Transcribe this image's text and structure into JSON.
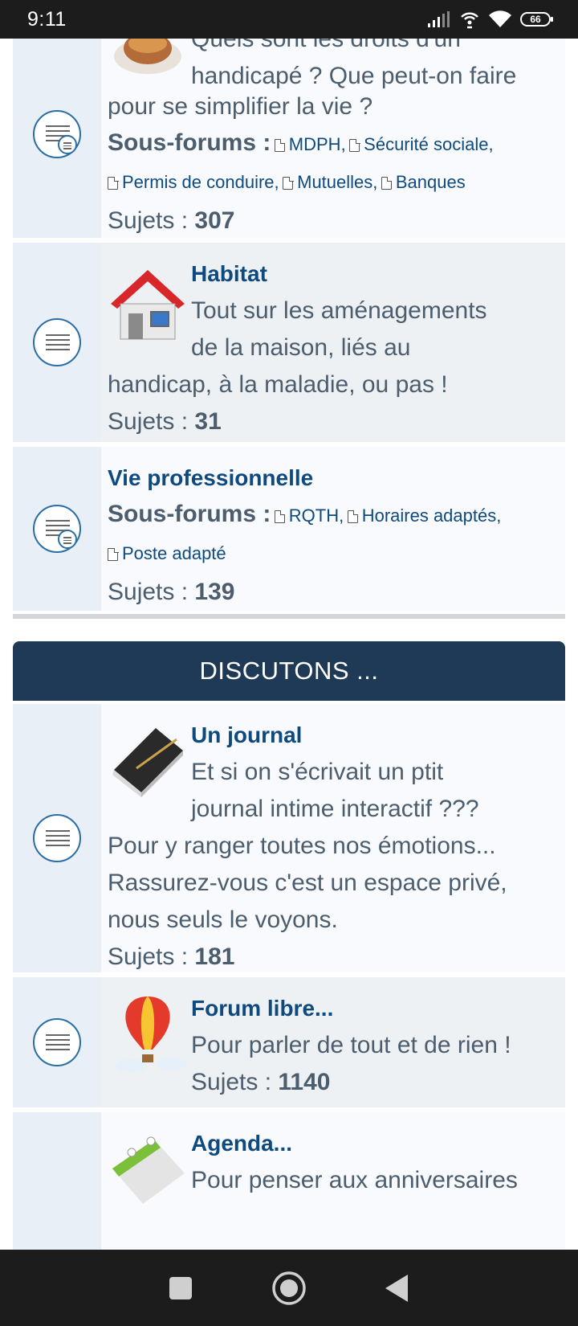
{
  "status_bar": {
    "time": "9:11",
    "battery": "66"
  },
  "forums_top": [
    {
      "desc_lines": [
        "Quels sont les droits d'un",
        "handicapé ? Que peut-on faire",
        "pour se simplifier la vie ?"
      ],
      "sub_label": "Sous-forums :",
      "subforums": [
        "MDPH",
        "Sécurité sociale",
        "Permis de conduire",
        "Mutuelles",
        "Banques"
      ],
      "topics_label": "Sujets :",
      "topics": "307"
    },
    {
      "title": "Habitat",
      "desc_lines": [
        "Tout sur les aménagements",
        "de la maison, liés au",
        "handicap, à la maladie, ou pas !"
      ],
      "topics_label": "Sujets :",
      "topics": "31"
    },
    {
      "title": "Vie professionnelle",
      "sub_label": "Sous-forums :",
      "subforums": [
        "RQTH",
        "Horaires adaptés",
        "Poste adapté"
      ],
      "topics_label": "Sujets :",
      "topics": "139"
    }
  ],
  "category": {
    "title": "DISCUTONS ..."
  },
  "forums_bottom": [
    {
      "title": "Un journal",
      "desc_lines": [
        "Et si on s'écrivait un ptit",
        "journal intime interactif ???",
        "Pour y ranger toutes nos émotions...",
        "Rassurez-vous c'est un espace privé,",
        "nous seuls le voyons."
      ],
      "topics_label": "Sujets :",
      "topics": "181"
    },
    {
      "title": "Forum libre...",
      "desc_lines": [
        "Pour parler de tout et de rien !"
      ],
      "topics_label": "Sujets :",
      "topics": "1140"
    },
    {
      "title": "Agenda...",
      "desc_lines": [
        "Pour penser aux anniversaires"
      ]
    }
  ],
  "icons": [
    "forum-read-icon",
    "forum-subforums-icon",
    "house-icon",
    "notebook-icon",
    "balloon-icon",
    "calendar-icon",
    "document-icon"
  ],
  "colors": {
    "header_bg": "#1f3a56",
    "link": "#0f4a7f",
    "text": "#4c5d6e"
  }
}
